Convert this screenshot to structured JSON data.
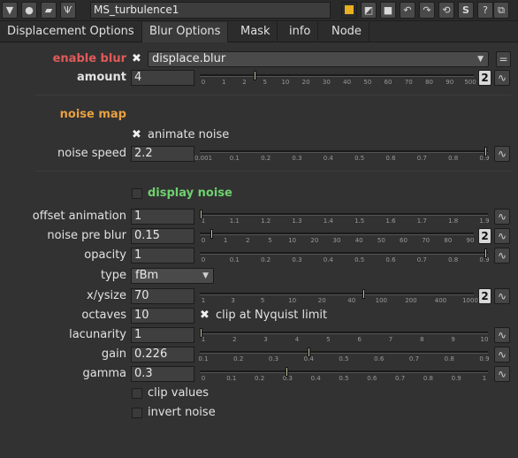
{
  "node_name": "MS_turbulence1",
  "tabs": [
    "Displacement Options",
    "Blur Options",
    "Mask",
    "info",
    "Node"
  ],
  "active_tab": "Blur Options",
  "enable_blur": {
    "label": "enable blur",
    "value": "displace.blur"
  },
  "amount": {
    "label": "amount",
    "value": "4",
    "ticks": [
      "0",
      "1",
      "2",
      "5",
      "10",
      "20",
      "30",
      "40",
      "50",
      "60",
      "70",
      "80",
      "90",
      "500"
    ],
    "count_label": "2"
  },
  "noise_map": {
    "heading": "noise map",
    "animate_label": "animate noise"
  },
  "noise_speed": {
    "label": "noise speed",
    "value": "2.2",
    "ticks": [
      "0.001",
      "0.1",
      "0.2",
      "0.3",
      "0.4",
      "0.5",
      "0.6",
      "0.7",
      "0.8",
      "0.9"
    ]
  },
  "display_noise": {
    "label": "display noise"
  },
  "offset_animation": {
    "label": "offset animation",
    "value": "1",
    "ticks": [
      "1",
      "1.1",
      "1.2",
      "1.3",
      "1.4",
      "1.5",
      "1.6",
      "1.7",
      "1.8",
      "1.9"
    ]
  },
  "noise_pre_blur": {
    "label": "noise pre blur",
    "value": "0.15",
    "ticks": [
      "0",
      "1",
      "2",
      "5",
      "10",
      "20",
      "30",
      "40",
      "50",
      "60",
      "70",
      "80",
      "90"
    ],
    "count_label": "2"
  },
  "opacity": {
    "label": "opacity",
    "value": "1",
    "ticks": [
      "0",
      "0.1",
      "0.2",
      "0.3",
      "0.4",
      "0.5",
      "0.6",
      "0.7",
      "0.8",
      "0.9"
    ]
  },
  "type": {
    "label": "type",
    "value": "fBm"
  },
  "xysize": {
    "label": "x/ysize",
    "value": "70",
    "ticks": [
      "1",
      "3",
      "5",
      "10",
      "20",
      "40",
      "100",
      "200",
      "400",
      "1000"
    ],
    "count_label": "2"
  },
  "octaves": {
    "label": "octaves",
    "value": "10",
    "clip_label": "clip at Nyquist limit"
  },
  "lacunarity": {
    "label": "lacunarity",
    "value": "1",
    "ticks": [
      "1",
      "2",
      "3",
      "4",
      "5",
      "6",
      "7",
      "8",
      "9",
      "10"
    ]
  },
  "gain": {
    "label": "gain",
    "value": "0.226",
    "ticks": [
      "0.1",
      "0.2",
      "0.3",
      "0.4",
      "0.5",
      "0.6",
      "0.7",
      "0.8",
      "0.9"
    ]
  },
  "gamma": {
    "label": "gamma",
    "value": "0.3",
    "ticks": [
      "0",
      "0.1",
      "0.2",
      "0.3",
      "0.4",
      "0.5",
      "0.6",
      "0.7",
      "0.8",
      "0.9",
      "1"
    ]
  },
  "clip_values": {
    "label": "clip values"
  },
  "invert_noise": {
    "label": "invert noise"
  },
  "colors": {
    "bg": "#323232",
    "red": "#e05a5a",
    "orange": "#e8a040",
    "green": "#6fd06f",
    "yellow": "#e8b020"
  }
}
